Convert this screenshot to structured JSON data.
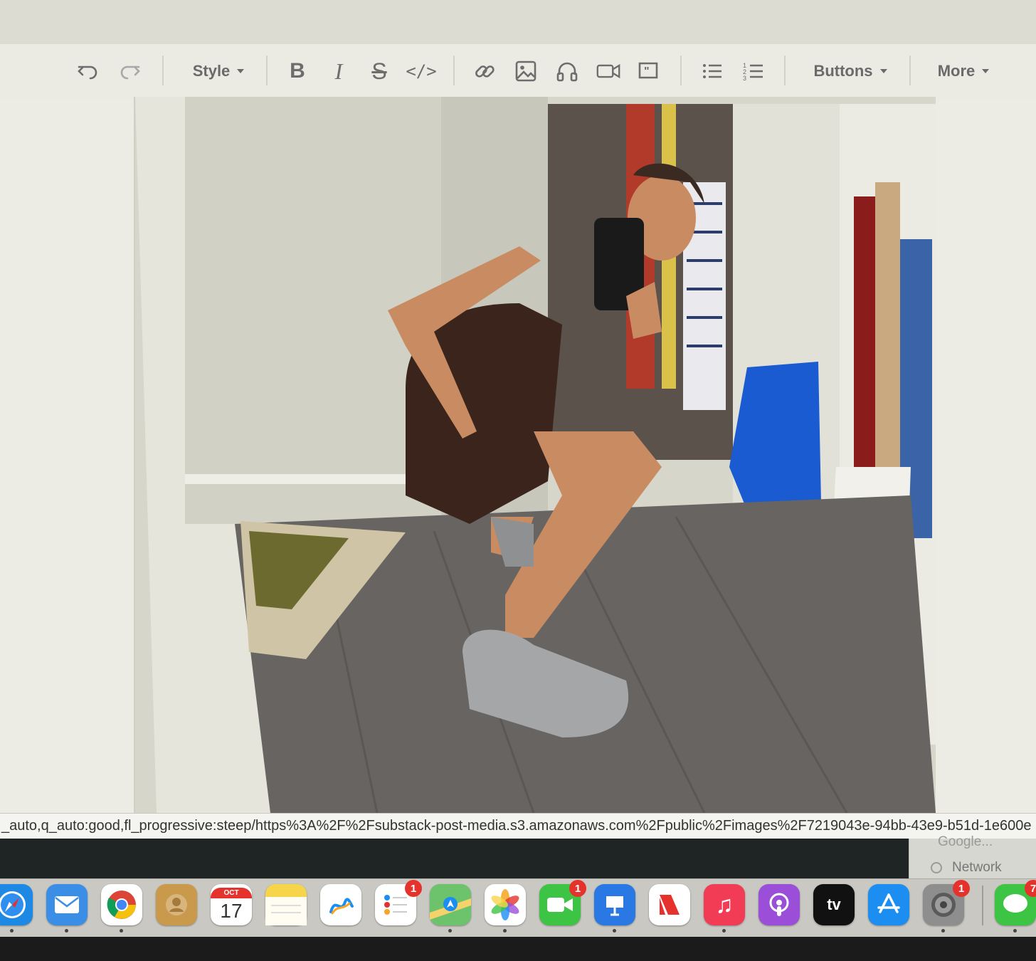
{
  "toolbar": {
    "style_label": "Style",
    "buttons_label": "Buttons",
    "more_label": "More",
    "items": [
      {
        "name": "undo-icon"
      },
      {
        "name": "redo-icon"
      },
      {
        "name": "bold-icon"
      },
      {
        "name": "italic-icon"
      },
      {
        "name": "strikethrough-icon"
      },
      {
        "name": "code-icon"
      },
      {
        "name": "link-icon"
      },
      {
        "name": "image-icon"
      },
      {
        "name": "audio-icon"
      },
      {
        "name": "video-icon"
      },
      {
        "name": "quote-icon"
      },
      {
        "name": "bullet-list-icon"
      },
      {
        "name": "numbered-list-icon"
      }
    ]
  },
  "status_url": "_auto,q_auto:good,fl_progressive:steep/https%3A%2F%2Fsubstack-post-media.s3.amazonaws.com%2Fpublic%2Fimages%2F7219043e-94bb-43e9-b51d-1e600e",
  "popup": {
    "ghost_label": "Google...",
    "network_label": "Network"
  },
  "dock": {
    "calendar_month": "OCT",
    "calendar_day": "17",
    "tv_label": "tv",
    "items": [
      {
        "name": "safari-icon",
        "color": "#1e88e5"
      },
      {
        "name": "mail-icon",
        "color": "#3b8ee6"
      },
      {
        "name": "chrome-icon",
        "color": "#ffffff"
      },
      {
        "name": "contacts-icon",
        "color": "#c99a4c"
      },
      {
        "name": "calendar-icon",
        "color": "#ffffff"
      },
      {
        "name": "notes-icon",
        "color": "#f7d54a"
      },
      {
        "name": "freeform-icon",
        "color": "#ffffff"
      },
      {
        "name": "reminders-icon",
        "color": "#ffffff",
        "badge": "1"
      },
      {
        "name": "maps-icon",
        "color": "#6cc36b"
      },
      {
        "name": "photos-icon",
        "color": "#ffffff"
      },
      {
        "name": "facetime-icon",
        "color": "#3ec444",
        "badge": "1"
      },
      {
        "name": "keynote-icon",
        "color": "#2a78e4"
      },
      {
        "name": "news-icon",
        "color": "#ffffff"
      },
      {
        "name": "music-icon",
        "color": "#f23c55"
      },
      {
        "name": "podcasts-icon",
        "color": "#9b4fd8"
      },
      {
        "name": "apple-tv-icon",
        "color": "#111111"
      },
      {
        "name": "app-store-icon",
        "color": "#1c8ef2"
      },
      {
        "name": "system-settings-icon",
        "color": "#8e8e8e",
        "badge": "1"
      },
      {
        "name": "messages-icon",
        "color": "#3ec444",
        "badge": "7"
      }
    ]
  }
}
